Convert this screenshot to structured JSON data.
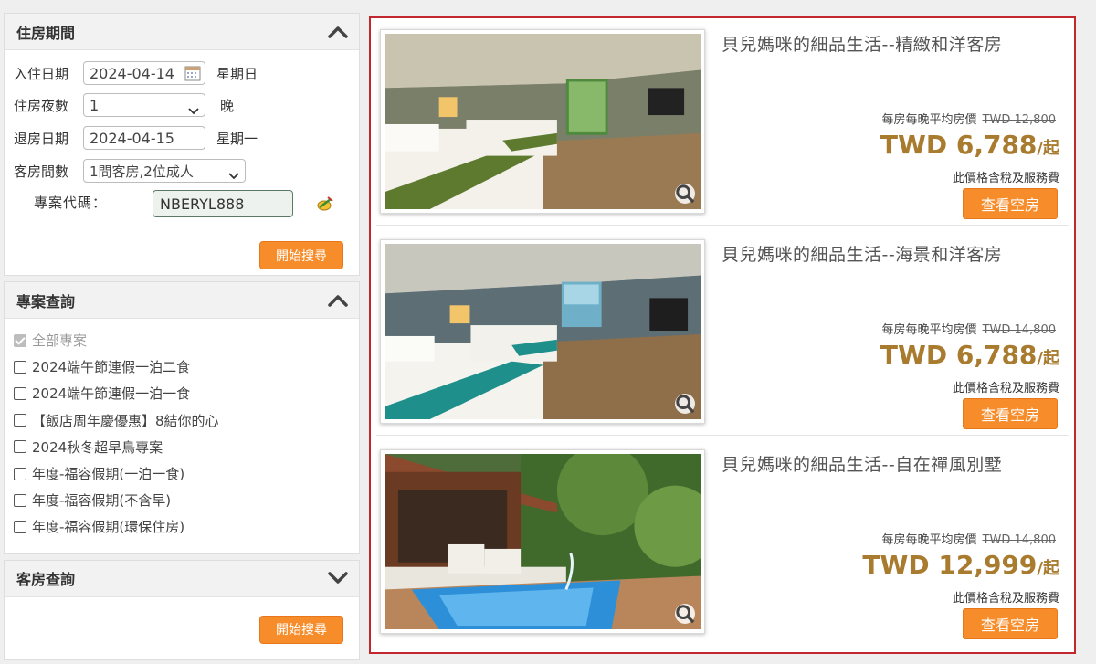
{
  "stay_panel": {
    "title": "住房期間",
    "checkin_label": "入住日期",
    "checkin_date": "2024-04-14",
    "checkin_weekday": "星期日",
    "nights_label": "住房夜數",
    "nights_value": "1",
    "nights_unit": "晚",
    "checkout_label": "退房日期",
    "checkout_date": "2024-04-15",
    "checkout_weekday": "星期一",
    "rooms_label": "客房間數",
    "rooms_value": "1間客房,2位成人",
    "promo_label": "專案代碼：",
    "promo_value": "NBERYL888",
    "search_button": "開始搜尋"
  },
  "project_panel": {
    "title": "專案查詢",
    "items": [
      "全部專案",
      "2024端午節連假一泊二食",
      "2024端午節連假一泊一食",
      "【飯店周年慶優惠】8結你的心",
      "2024秋冬超早鳥專案",
      "年度-福容假期(一泊一食)",
      "年度-福容假期(不含早)",
      "年度-福容假期(環保住房)"
    ]
  },
  "room_panel": {
    "title": "客房查詢",
    "search_button": "開始搜尋"
  },
  "rooms": [
    {
      "title": "貝兒媽咪的細品生活--精緻和洋客房",
      "avg_label": "每房每晚平均房價",
      "original_price": "TWD 12,800",
      "price": "TWD 6,788",
      "price_unit": "/起",
      "tax_note": "此價格含稅及服務費",
      "button": "查看空房"
    },
    {
      "title": "貝兒媽咪的細品生活--海景和洋客房",
      "avg_label": "每房每晚平均房價",
      "original_price": "TWD 14,800",
      "price": "TWD 6,788",
      "price_unit": "/起",
      "tax_note": "此價格含稅及服務費",
      "button": "查看空房"
    },
    {
      "title": "貝兒媽咪的細品生活--自在禪風別墅",
      "avg_label": "每房每晚平均房價",
      "original_price": "TWD 14,800",
      "price": "TWD 12,999",
      "price_unit": "/起",
      "tax_note": "此價格含稅及服務費",
      "button": "查看空房"
    }
  ],
  "colors": {
    "accent_orange": "#f78d2a",
    "price_gold": "#a87b2e",
    "highlight_border": "#c1272d"
  }
}
